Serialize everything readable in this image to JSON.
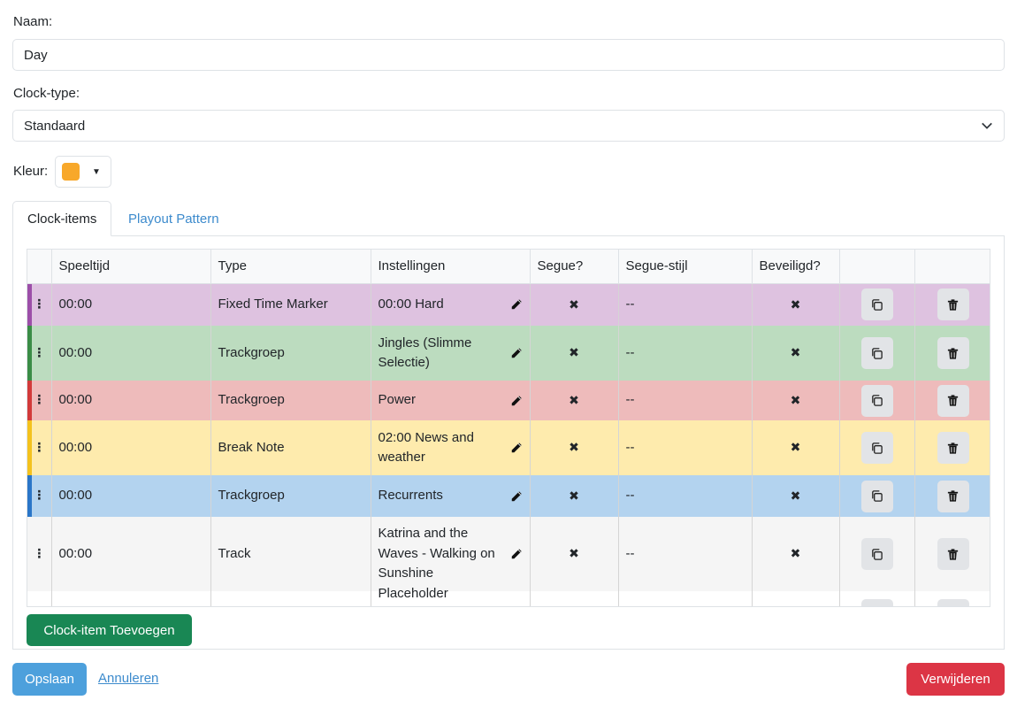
{
  "form": {
    "name_label": "Naam:",
    "name_value": "Day",
    "clock_type_label": "Clock-type:",
    "clock_type_value": "Standaard",
    "color_label": "Kleur:",
    "color_value": "#f8a82a"
  },
  "tabs": [
    {
      "label": "Clock-items",
      "active": true
    },
    {
      "label": "Playout Pattern",
      "active": false
    }
  ],
  "table": {
    "columns": [
      "",
      "Speeltijd",
      "Type",
      "Instellingen",
      "Segue?",
      "Segue-stijl",
      "Beveiligd?",
      "",
      ""
    ],
    "rows": [
      {
        "time": "00:00",
        "type": "Fixed Time Marker",
        "settings": "00:00 Hard",
        "segue": "✖",
        "segue_style": "--",
        "protected": "✖",
        "bg": "#dec2e0",
        "stripe": "#9c4fa8"
      },
      {
        "time": "00:00",
        "type": "Trackgroep",
        "settings": "Jingles (Slimme Selectie)",
        "segue": "✖",
        "segue_style": "--",
        "protected": "✖",
        "bg": "#bcdcbf",
        "stripe": "#3a8c46"
      },
      {
        "time": "00:00",
        "type": "Trackgroep",
        "settings": "Power",
        "segue": "✖",
        "segue_style": "--",
        "protected": "✖",
        "bg": "#eebbbb",
        "stripe": "#d23a3a"
      },
      {
        "time": "00:00",
        "type": "Break Note",
        "settings": "02:00 News and weather",
        "segue": "✖",
        "segue_style": "--",
        "protected": "✖",
        "bg": "#feebad",
        "stripe": "#f4c21d"
      },
      {
        "time": "00:00",
        "type": "Trackgroep",
        "settings": "Recurrents",
        "segue": "✖",
        "segue_style": "--",
        "protected": "✖",
        "bg": "#b3d3ef",
        "stripe": "#2a76c8"
      },
      {
        "time": "00:00",
        "type": "Track",
        "settings": "Katrina and the Waves - Walking on Sunshine",
        "segue": "✖",
        "segue_style": "--",
        "protected": "✖",
        "bg": "#f5f5f5",
        "stripe": ""
      },
      {
        "time": "",
        "type": "",
        "settings": "Placeholder duration:",
        "segue": "",
        "segue_style": "",
        "protected": "",
        "bg": "#ffffff",
        "stripe": ""
      }
    ]
  },
  "buttons": {
    "add_item": "Clock-item Toevoegen",
    "save": "Opslaan",
    "cancel": "Annuleren",
    "delete": "Verwijderen"
  },
  "icons": {
    "select_chevron": "chevron-down-icon",
    "color_caret": "caret-down-icon",
    "drag": "drag-handle-icon",
    "edit": "pencil-icon",
    "copy": "copy-icon",
    "delete": "trash-icon"
  }
}
